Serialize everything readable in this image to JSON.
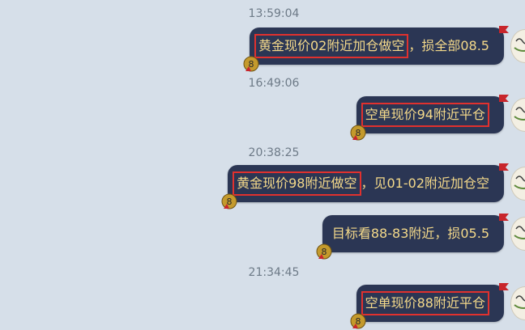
{
  "messages": [
    {
      "timestamp": "13:59:04",
      "highlight": "黄金现价02附近加仓做空",
      "rest": "，损全部08.5"
    },
    {
      "timestamp": "16:49:06",
      "highlight": "空单现价94附近平仓",
      "rest": ""
    },
    {
      "timestamp": "20:38:25",
      "highlight": "黄金现价98附近做空",
      "rest": "，见01-02附近加仓空"
    },
    {
      "timestamp": "",
      "highlight": "",
      "rest": "目标看88-83附近，损05.5"
    },
    {
      "timestamp": "21:34:45",
      "highlight": "空单现价88附近平仓",
      "rest": ""
    }
  ],
  "badge_text": "8",
  "colors": {
    "background": "#d6dfe9",
    "bubble": "#2b3654",
    "text": "#f4d98a",
    "highlight_border": "#e0312e"
  }
}
